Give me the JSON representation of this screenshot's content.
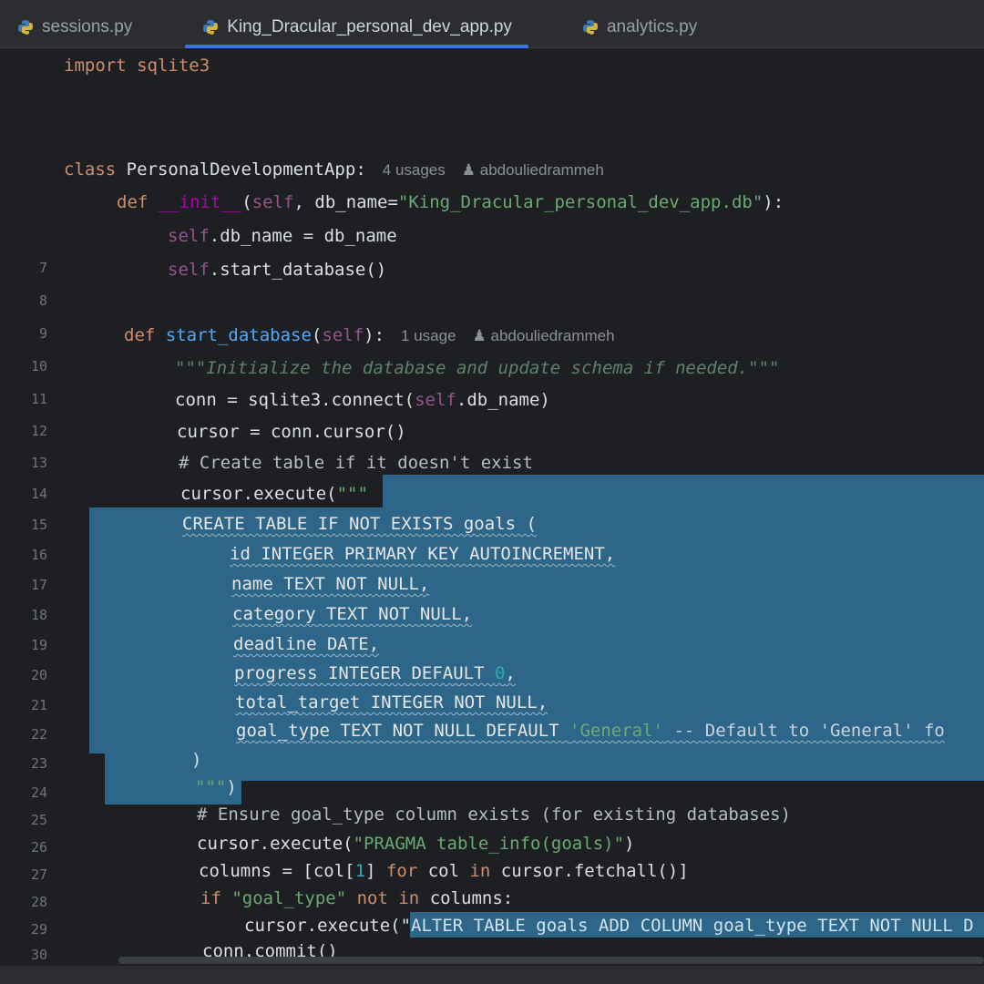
{
  "tabs": [
    {
      "label": "sessions.py",
      "active": false
    },
    {
      "label": "King_Dracular_personal_dev_app.py",
      "active": true
    },
    {
      "label": "analytics.py",
      "active": false
    }
  ],
  "hints": {
    "class_usages": "4 usages",
    "method_usages": "1 usage",
    "author": "abdouliedrammeh"
  },
  "code": {
    "l1": "import sqlite3",
    "l4_kw": "class ",
    "l4_name": "PersonalDevelopmentApp",
    "l4_rest": ":",
    "l5_def": "def ",
    "l5_init": "__init__",
    "l5_a": "(",
    "l5_self": "self",
    "l5_b": ", db_name=",
    "l5_str": "\"King_Dracular_personal_dev_app.db\"",
    "l5_c": "):",
    "l6_self": "self",
    "l6_rest": ".db_name = db_name",
    "l7_self": "self",
    "l7_rest": ".start_database()",
    "l9_def": "def ",
    "l9_name": "start_database",
    "l9_a": "(",
    "l9_self": "self",
    "l9_b": "):",
    "l10": "\"\"\"Initialize the database and update schema if needed.\"\"\"",
    "l11_a": "conn = sqlite3.connect(",
    "l11_self": "self",
    "l11_b": ".db_name)",
    "l12": "cursor = conn.cursor()",
    "l13": "# Create table if it doesn't exist",
    "l14_a": "cursor.execute(",
    "l14_b": "\"\"\"",
    "l15": "CREATE TABLE IF NOT EXISTS goals (",
    "l16": "id INTEGER PRIMARY KEY AUTOINCREMENT,",
    "l17": "name TEXT NOT NULL,",
    "l18": "category TEXT NOT NULL,",
    "l19": "deadline DATE,",
    "l20_a": "progress INTEGER DEFAULT ",
    "l20_num": "0",
    "l20_b": ",",
    "l21": "total_target INTEGER NOT NULL,",
    "l22_a": "goal_type TEXT NOT NULL DEFAULT ",
    "l22_str": "'General'",
    "l22_cm": " -- Default to 'General' fo",
    "l23": ")",
    "l24_a": "\"\"\"",
    "l24_b": ")",
    "l25": "# Ensure goal_type column exists (for existing databases)",
    "l26_a": "cursor.execute(",
    "l26_str": "\"PRAGMA table_info(goals)\"",
    "l26_b": ")",
    "l27_a": "columns = [col[",
    "l27_num": "1",
    "l27_b": "] ",
    "l27_for": "for",
    "l27_c": " col ",
    "l27_in": "in",
    "l27_d": " cursor.fetchall()]",
    "l28_if": "if ",
    "l28_str": "\"goal_type\"",
    "l28_not": " not in",
    "l28_b": " columns:",
    "l29_a": "cursor.execute(",
    "l29_str": "\"ALTER TABLE goals ADD COLUMN goal_type TEXT NOT NULL D",
    "l30": "conn.commit()"
  },
  "line_numbers": [
    "7",
    "8",
    "9",
    "10",
    "11",
    "12",
    "13",
    "14",
    "15",
    "16",
    "17",
    "18",
    "19",
    "20",
    "21",
    "22",
    "23",
    "24",
    "25",
    "26",
    "27",
    "28",
    "29",
    "30"
  ],
  "colors": {
    "background": "#1e1f22",
    "selection": "#2f6e94",
    "keyword": "#cf8e6d",
    "function": "#56a8f5",
    "self": "#94558d",
    "string": "#6aab73",
    "tab_underline": "#3574f0"
  }
}
